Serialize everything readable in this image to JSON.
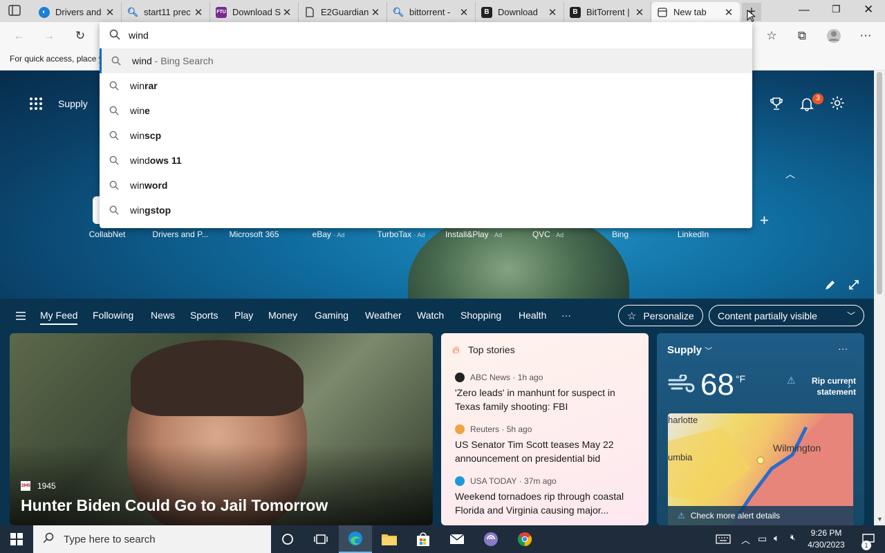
{
  "tabs": [
    {
      "title": "Drivers and",
      "favicon": "edge-drivers-icon"
    },
    {
      "title": "start11 prec",
      "favicon": "search-icon"
    },
    {
      "title": "Download S",
      "favicon": "ftu-icon",
      "favicon_text": "FTU"
    },
    {
      "title": "E2Guardian",
      "favicon": "document-icon"
    },
    {
      "title": "bittorrent -",
      "favicon": "search-icon"
    },
    {
      "title": "Download",
      "favicon": "b-icon",
      "favicon_text": "B"
    },
    {
      "title": "BitTorrent |",
      "favicon": "b-icon",
      "favicon_text": "B"
    },
    {
      "title": "New tab",
      "favicon": "newtab-icon"
    }
  ],
  "address": {
    "value": "wind"
  },
  "favbar": {
    "text": "For quick access, place y"
  },
  "suggestions": [
    {
      "typed": "wind",
      "rest": "",
      "hint": " - Bing Search"
    },
    {
      "typed": "win",
      "rest": "rar",
      "hint": ""
    },
    {
      "typed": "win",
      "rest": "e",
      "hint": ""
    },
    {
      "typed": "win",
      "rest": "scp",
      "hint": ""
    },
    {
      "typed": "wind",
      "rest": "ows 11",
      "hint": ""
    },
    {
      "typed": "win",
      "rest": "word",
      "hint": ""
    },
    {
      "typed": "win",
      "rest": "gstop",
      "hint": ""
    }
  ],
  "hero": {
    "location_label": "Supply",
    "notification_count": "3"
  },
  "quicklinks": [
    {
      "label": "CollabNet",
      "ad": ""
    },
    {
      "label": "Drivers and P...",
      "ad": ""
    },
    {
      "label": "Microsoft 365",
      "ad": ""
    },
    {
      "label": "eBay",
      "ad": "· Ad"
    },
    {
      "label": "TurboTax",
      "ad": "· Ad"
    },
    {
      "label": "Install&Play",
      "ad": "· Ad"
    },
    {
      "label": "QVC",
      "ad": "· Ad"
    },
    {
      "label": "Bing",
      "ad": ""
    },
    {
      "label": "LinkedIn",
      "ad": ""
    }
  ],
  "feednav": [
    "My Feed",
    "Following",
    "News",
    "Sports",
    "Play",
    "Money",
    "Gaming",
    "Weather",
    "Watch",
    "Shopping",
    "Health"
  ],
  "feedbuttons": {
    "personalize": "Personalize",
    "content": "Content partially visible"
  },
  "maincard": {
    "source": "1945",
    "headline": "Hunter Biden Could Go to Jail Tomorrow"
  },
  "topstories": {
    "heading": "Top stories",
    "items": [
      {
        "source": "ABC News",
        "time": "· 1h ago",
        "title": "'Zero leads' in manhunt for suspect in Texas family shooting: FBI"
      },
      {
        "source": "Reuters",
        "time": "· 5h ago",
        "title": "US Senator Tim Scott teases May 22 announcement on presidential bid"
      },
      {
        "source": "USA TODAY",
        "time": "· 37m ago",
        "title": "Weekend tornadoes rip through coastal Florida and Virginia causing major..."
      }
    ]
  },
  "weather": {
    "location": "Supply",
    "temp": "68",
    "unit": "°F",
    "alert_line1": "Rip current",
    "alert_line2": "statement",
    "map_label_1": "harlotte",
    "map_label_2": "umbia",
    "map_label_3": "Wilmington",
    "alert_link": "Check more alert details"
  },
  "taskbar": {
    "search_placeholder": "Type here to search",
    "time": "9:26 PM",
    "date": "4/30/2023",
    "notif_count": "1"
  },
  "colors": {
    "accent": "#0f6cbd",
    "badge": "#e8562a",
    "taskbar": "#1f2c3c"
  }
}
